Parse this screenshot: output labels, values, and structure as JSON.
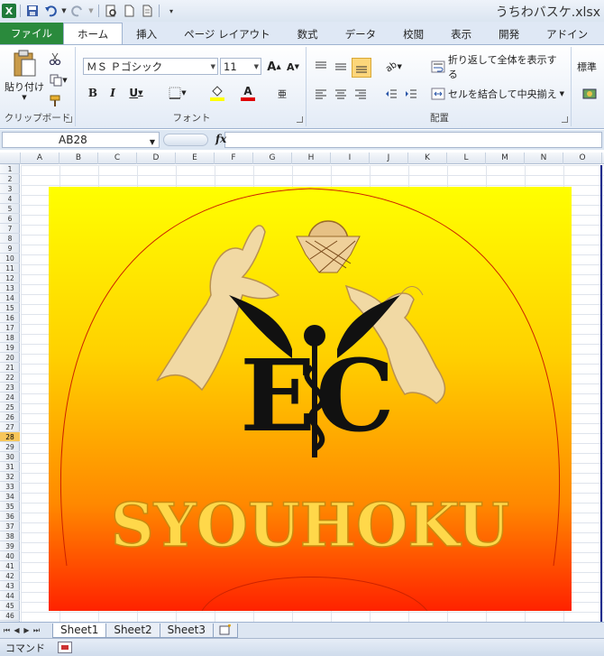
{
  "window": {
    "title": "うちわバスケ.xlsx"
  },
  "tabs": [
    "ファイル",
    "ホーム",
    "挿入",
    "ページ レイアウト",
    "数式",
    "データ",
    "校閲",
    "表示",
    "開発",
    "アドイン"
  ],
  "ribbon": {
    "clipboard": {
      "paste_label": "貼り付け",
      "group_label": "クリップボード"
    },
    "font": {
      "family": "ＭＳ Ｐゴシック",
      "size": "11",
      "group_label": "フォント"
    },
    "alignment": {
      "wrap_label": "折り返して全体を表示する",
      "merge_label": "セルを結合して中央揃え",
      "group_label": "配置"
    },
    "number": {
      "format": "標準"
    }
  },
  "formula_bar": {
    "name_box": "AB28",
    "fx": "fx",
    "value": ""
  },
  "columns": [
    "A",
    "B",
    "C",
    "D",
    "E",
    "F",
    "G",
    "H",
    "I",
    "J",
    "K",
    "L",
    "M",
    "N",
    "O"
  ],
  "rows": [
    "1",
    "2",
    "3",
    "4",
    "5",
    "6",
    "7",
    "8",
    "9",
    "10",
    "11",
    "12",
    "13",
    "14",
    "15",
    "16",
    "17",
    "18",
    "19",
    "20",
    "21",
    "22",
    "23",
    "24",
    "25",
    "26",
    "27",
    "28",
    "29",
    "30",
    "31",
    "32",
    "33",
    "34",
    "35",
    "36",
    "37",
    "38",
    "39",
    "40",
    "41",
    "42",
    "43",
    "44",
    "45",
    "46"
  ],
  "selected_row": "28",
  "picture": {
    "text": "SYOUHOKU",
    "emblem_letters": "EC"
  },
  "sheets": [
    "Sheet1",
    "Sheet2",
    "Sheet3"
  ],
  "active_sheet": "Sheet1",
  "status": {
    "mode": "コマンド"
  }
}
